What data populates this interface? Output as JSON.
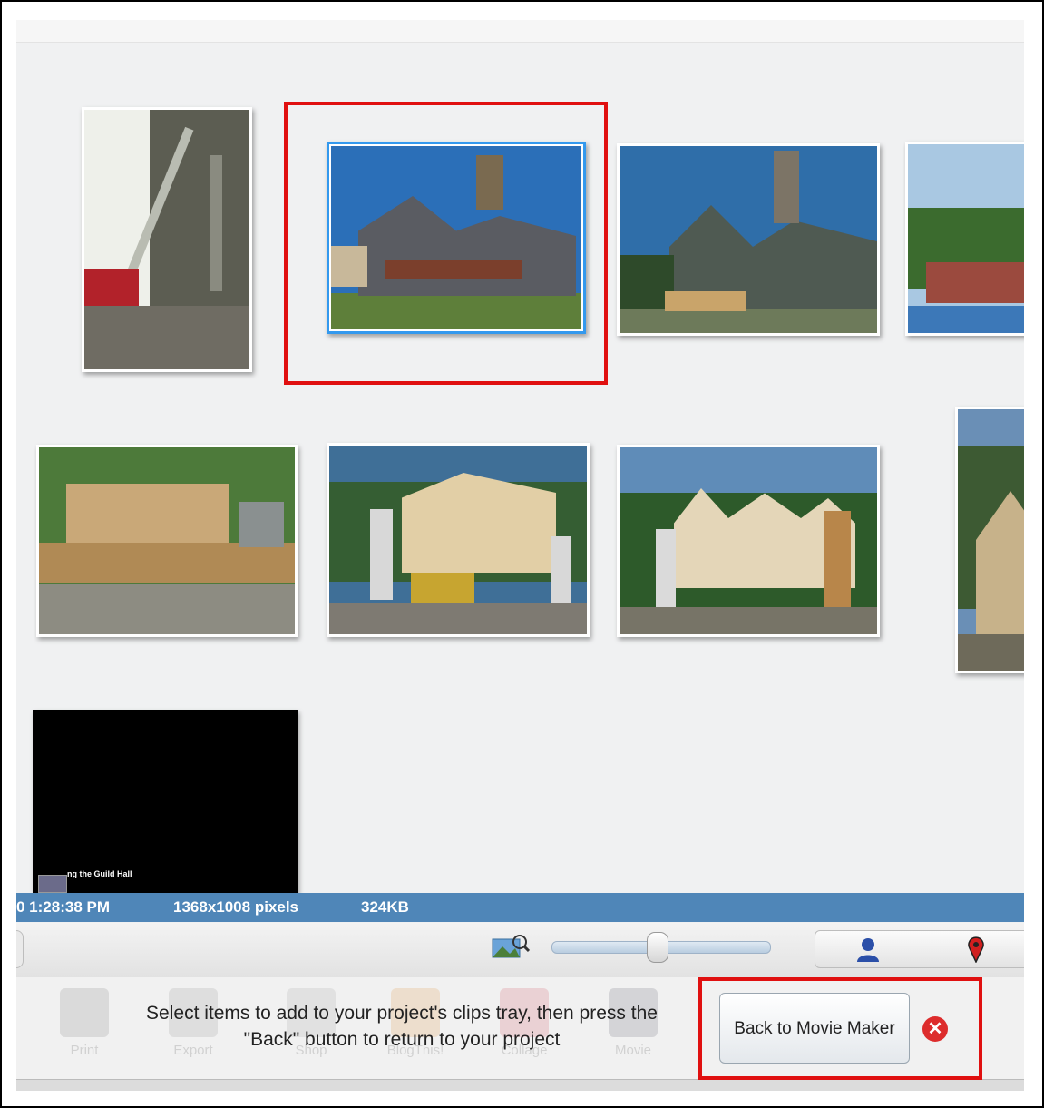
{
  "status": {
    "time": "0 1:28:38 PM",
    "dimensions": "1368x1008 pixels",
    "size": "324KB"
  },
  "video_caption": "ng the Guild Hall",
  "instruction": {
    "line1": "Select items to add to your project's clips tray, then press the",
    "line2": "\"Back\" button to return to your project"
  },
  "back_button_label": "Back to Movie Maker",
  "close_glyph": "✕",
  "ghost_tools": [
    "Print",
    "Export",
    "Shop",
    "BlogThis!",
    "Collage",
    "Movie"
  ],
  "toolbar_icons": {
    "zoom": "zoom-image-icon",
    "people": "person-icon",
    "places": "map-pin-icon"
  },
  "colors": {
    "status_bar": "#4f86b8",
    "selection": "#3399ee",
    "highlight": "#e01010",
    "close": "#dd2c2c"
  }
}
